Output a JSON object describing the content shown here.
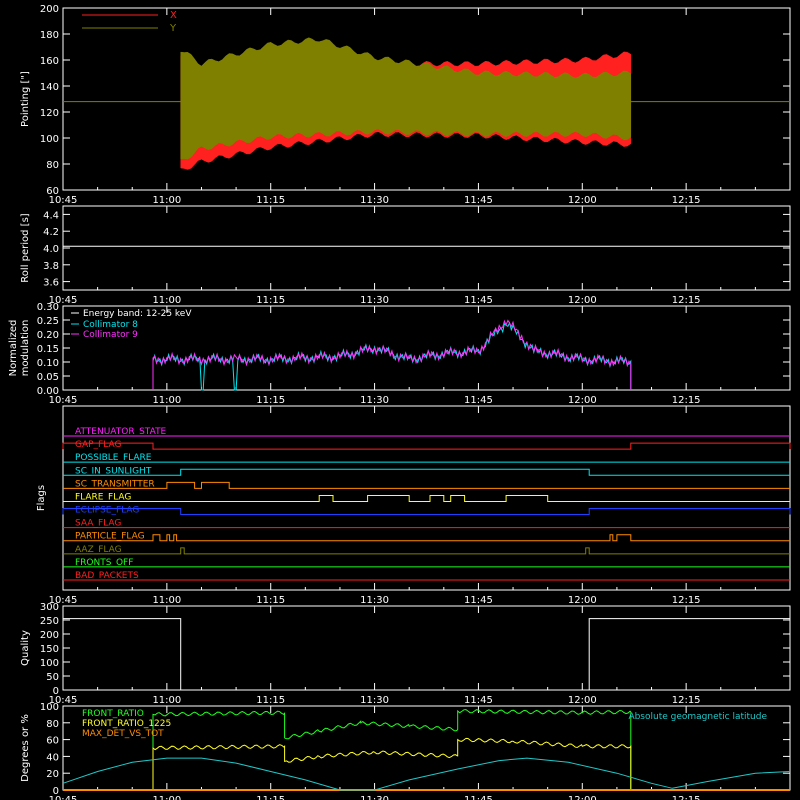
{
  "colors": {
    "background": "#000000",
    "axes": "#ffffff",
    "x_series": "#ff2020",
    "y_series": "#808000",
    "collimator8": "#00e5ee",
    "collimator9": "#ff30ff",
    "quality": "#ffffff",
    "front_ratio": "#20ff20",
    "front_ratio_1225": "#ffff20",
    "max_det_vs_tot": "#ff8c00",
    "geomag_lat": "#20c8c8"
  },
  "chart_data": [
    {
      "id": "pointing",
      "type": "area",
      "ylabel": "Pointing [\"]",
      "ylim": [
        60,
        200
      ],
      "yticks": [
        60,
        80,
        100,
        120,
        140,
        160,
        180,
        200
      ],
      "xlim": [
        "10:45",
        "12:30"
      ],
      "xticks": [
        "10:45",
        "11:00",
        "11:15",
        "11:30",
        "11:45",
        "12:00",
        "12:15"
      ],
      "legend": {
        "position": "top-left",
        "items": [
          {
            "label": "X",
            "color": "#ff2020"
          },
          {
            "label": "Y",
            "color": "#808000"
          }
        ]
      },
      "series": [
        {
          "name": "X",
          "baseline": 128,
          "active": [
            "11:02",
            "12:07"
          ],
          "upper": [
            [
              "11:02",
              165
            ],
            [
              "11:05",
              150
            ],
            [
              "11:15",
              155
            ],
            [
              "11:30",
              157
            ],
            [
              "11:45",
              157
            ],
            [
              "12:00",
              160
            ],
            [
              "12:07",
              165
            ]
          ],
          "lower": [
            [
              "11:02",
              75
            ],
            [
              "11:05",
              82
            ],
            [
              "11:15",
              93
            ],
            [
              "11:30",
              103
            ],
            [
              "11:45",
              102
            ],
            [
              "12:00",
              97
            ],
            [
              "12:07",
              95
            ]
          ]
        },
        {
          "name": "Y",
          "baseline": 128,
          "active": [
            "11:02",
            "12:07"
          ],
          "upper": [
            [
              "11:02",
              168
            ],
            [
              "11:05",
              157
            ],
            [
              "11:15",
              172
            ],
            [
              "11:22",
              176
            ],
            [
              "11:30",
              162
            ],
            [
              "11:45",
              150
            ],
            [
              "12:00",
              148
            ],
            [
              "12:07",
              150
            ]
          ],
          "lower": [
            [
              "11:02",
              82
            ],
            [
              "11:05",
              92
            ],
            [
              "11:15",
              101
            ],
            [
              "11:30",
              105
            ],
            [
              "11:45",
              103
            ],
            [
              "12:00",
              103
            ],
            [
              "12:07",
              100
            ]
          ]
        }
      ]
    },
    {
      "id": "roll",
      "type": "line",
      "ylabel": "Roll period [s]",
      "ylim": [
        3.5,
        4.5
      ],
      "yticks": [
        3.6,
        3.8,
        4.0,
        4.2,
        4.4
      ],
      "xlim": [
        "10:45",
        "12:30"
      ],
      "xticks": [
        "10:45",
        "11:00",
        "11:15",
        "11:30",
        "11:45",
        "12:00",
        "12:15"
      ],
      "series": [
        {
          "name": "",
          "values": [
            [
              "10:45",
              4.02
            ],
            [
              "12:30",
              4.02
            ]
          ]
        }
      ]
    },
    {
      "id": "modulation",
      "type": "line",
      "ylabel": "Normalized modulation",
      "ylim": [
        0,
        0.3
      ],
      "yticks": [
        0.0,
        0.05,
        0.1,
        0.15,
        0.2,
        0.25,
        0.3
      ],
      "xlim": [
        "10:45",
        "12:30"
      ],
      "xticks": [
        "10:45",
        "11:00",
        "11:15",
        "11:30",
        "11:45",
        "12:00",
        "12:15"
      ],
      "legend": {
        "position": "top-left",
        "title": "Energy band: 12-25 keV",
        "items": [
          {
            "label": "Collimator 8",
            "color": "#00e5ee"
          },
          {
            "label": "Collimator 9",
            "color": "#ff30ff"
          }
        ]
      },
      "series": [
        {
          "name": "Collimator 8",
          "active": [
            "10:58",
            "12:07"
          ],
          "dropouts": [
            [
              "11:05",
              "11:10"
            ]
          ],
          "envelope": [
            [
              "10:58",
              0.11
            ],
            [
              "11:15",
              0.11
            ],
            [
              "11:25",
              0.12
            ],
            [
              "11:30",
              0.15
            ],
            [
              "11:35",
              0.11
            ],
            [
              "11:40",
              0.13
            ],
            [
              "11:45",
              0.14
            ],
            [
              "11:49",
              0.24
            ],
            [
              "11:53",
              0.14
            ],
            [
              "12:00",
              0.11
            ],
            [
              "12:07",
              0.1
            ]
          ]
        },
        {
          "name": "Collimator 9",
          "active": [
            "10:58",
            "12:07"
          ],
          "envelope": [
            [
              "10:58",
              0.11
            ],
            [
              "11:15",
              0.11
            ],
            [
              "11:25",
              0.12
            ],
            [
              "11:30",
              0.15
            ],
            [
              "11:35",
              0.11
            ],
            [
              "11:40",
              0.13
            ],
            [
              "11:45",
              0.14
            ],
            [
              "11:49",
              0.25
            ],
            [
              "11:53",
              0.14
            ],
            [
              "12:00",
              0.11
            ],
            [
              "12:07",
              0.1
            ]
          ]
        }
      ]
    },
    {
      "id": "flags",
      "type": "line",
      "ylabel": "Flags",
      "xlim": [
        "10:45",
        "12:30"
      ],
      "xticks": [
        "10:45",
        "11:00",
        "11:15",
        "11:30",
        "11:45",
        "12:00",
        "12:15"
      ],
      "series": [
        {
          "name": "ATTENUATOR_STATE",
          "color": "#ff20ff",
          "on": []
        },
        {
          "name": "GAP_FLAG",
          "color": "#ff2020",
          "on": [
            [
              "10:45",
              "10:58"
            ],
            [
              "12:07",
              "12:30"
            ]
          ]
        },
        {
          "name": "POSSIBLE_FLARE",
          "color": "#00e5ee",
          "on": []
        },
        {
          "name": "SC_IN_SUNLIGHT",
          "color": "#00e5ee",
          "on": [
            [
              "11:02",
              "12:01"
            ]
          ]
        },
        {
          "name": "SC_TRANSMITTER",
          "color": "#ff8c00",
          "on": [
            [
              "11:00",
              "11:04"
            ],
            [
              "11:05",
              "11:09"
            ]
          ]
        },
        {
          "name": "FLARE_FLAG",
          "color": "#ffff20",
          "on": [
            [
              "11:22",
              "11:24"
            ],
            [
              "11:29",
              "11:35"
            ],
            [
              "11:38",
              "11:40"
            ],
            [
              "11:41",
              "11:43"
            ],
            [
              "11:49",
              "11:55"
            ]
          ]
        },
        {
          "name": "ECLIPSE_FLAG",
          "color": "#2040ff",
          "on": [
            [
              "10:45",
              "11:02"
            ],
            [
              "12:01",
              "12:30"
            ]
          ]
        },
        {
          "name": "SAA_FLAG",
          "color": "#ff2020",
          "on": []
        },
        {
          "name": "PARTICLE_FLAG",
          "color": "#ff8c00",
          "on": [
            [
              "10:58",
              "10:59"
            ],
            [
              "11:00",
              "11:00.4"
            ],
            [
              "11:01",
              "11:01.4"
            ],
            [
              "12:04",
              "12:04.4"
            ],
            [
              "12:05",
              "12:07"
            ]
          ]
        },
        {
          "name": "AAZ_FLAG",
          "color": "#808000",
          "on": [
            [
              "11:02",
              "11:02.5"
            ],
            [
              "12:00.5",
              "12:01"
            ]
          ]
        },
        {
          "name": "FRONTS_OFF",
          "color": "#20ff20",
          "on": []
        },
        {
          "name": "BAD_PACKETS",
          "color": "#ff2020",
          "on": []
        }
      ]
    },
    {
      "id": "quality",
      "type": "line",
      "ylabel": "Quality",
      "ylim": [
        0,
        300
      ],
      "yticks": [
        0,
        50,
        100,
        150,
        200,
        250,
        300
      ],
      "xlim": [
        "10:45",
        "12:30"
      ],
      "xticks": [
        "10:45",
        "11:00",
        "11:15",
        "11:30",
        "11:45",
        "12:00",
        "12:15"
      ],
      "series": [
        {
          "name": "",
          "values": [
            [
              "10:45",
              255
            ],
            [
              "11:02",
              255
            ],
            [
              "11:02",
              0
            ],
            [
              "12:01",
              0
            ],
            [
              "12:01",
              255
            ],
            [
              "12:30",
              255
            ]
          ]
        }
      ]
    },
    {
      "id": "ratios",
      "type": "line",
      "ylabel": "Degrees or %",
      "ylim": [
        0,
        100
      ],
      "yticks": [
        0,
        20,
        40,
        60,
        80,
        100
      ],
      "xlim": [
        "10:45",
        "12:30"
      ],
      "xticks": [
        "10:45",
        "11:00",
        "11:15",
        "11:30",
        "11:45",
        "12:00",
        "12:15"
      ],
      "legend": {
        "position": "top-left",
        "items": [
          {
            "label": "FRONT_RATIO",
            "color": "#20ff20"
          },
          {
            "label": "FRONT_RATIO_1225",
            "color": "#ffff20"
          },
          {
            "label": "MAX_DET_VS_TOT",
            "color": "#ff8c00"
          }
        ]
      },
      "annotation": {
        "text": "Absolute geomagnetic latitude",
        "position": "top-right"
      },
      "series": [
        {
          "name": "FRONT_RATIO",
          "values": [
            [
              "10:58",
              0
            ],
            [
              "10:58",
              90
            ],
            [
              "11:17",
              92
            ],
            [
              "11:17",
              62
            ],
            [
              "11:22",
              70
            ],
            [
              "11:28",
              80
            ],
            [
              "11:35",
              76
            ],
            [
              "11:42",
              72
            ],
            [
              "11:42",
              94
            ],
            [
              "12:00",
              92
            ],
            [
              "12:07",
              93
            ],
            [
              "12:07",
              0
            ]
          ]
        },
        {
          "name": "FRONT_RATIO_1225",
          "values": [
            [
              "10:58",
              0
            ],
            [
              "10:58",
              50
            ],
            [
              "11:17",
              52
            ],
            [
              "11:17",
              34
            ],
            [
              "11:22",
              40
            ],
            [
              "11:30",
              45
            ],
            [
              "11:42",
              40
            ],
            [
              "11:42",
              60
            ],
            [
              "11:50",
              58
            ],
            [
              "12:00",
              52
            ],
            [
              "12:07",
              52
            ],
            [
              "12:07",
              0
            ]
          ]
        },
        {
          "name": "MAX_DET_VS_TOT",
          "values": [
            [
              "10:45",
              0
            ],
            [
              "12:30",
              0
            ]
          ]
        },
        {
          "name": "Absolute geomagnetic latitude",
          "values": [
            [
              "10:45",
              8
            ],
            [
              "10:50",
              22
            ],
            [
              "10:55",
              33
            ],
            [
              "11:00",
              38
            ],
            [
              "11:05",
              38
            ],
            [
              "11:10",
              32
            ],
            [
              "11:15",
              22
            ],
            [
              "11:20",
              12
            ],
            [
              "11:25",
              0
            ],
            [
              "11:30",
              0
            ],
            [
              "11:35",
              12
            ],
            [
              "11:42",
              25
            ],
            [
              "11:48",
              35
            ],
            [
              "11:52",
              38
            ],
            [
              "11:58",
              33
            ],
            [
              "12:05",
              20
            ],
            [
              "12:10",
              8
            ],
            [
              "12:13",
              2
            ],
            [
              "12:18",
              10
            ],
            [
              "12:25",
              20
            ],
            [
              "12:30",
              22
            ]
          ]
        }
      ]
    }
  ]
}
